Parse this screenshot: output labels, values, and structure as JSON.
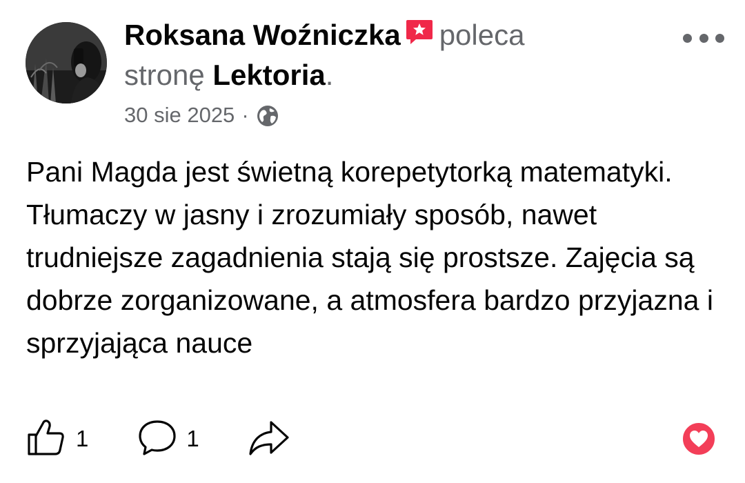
{
  "post": {
    "author": "Roksana Woźniczka",
    "recommends_text": "poleca",
    "page_prefix": "stronę",
    "page_name": "Lektoria",
    "page_suffix": ".",
    "date": "30 sie 2025",
    "separator": "·",
    "body": "Pani Magda jest świetną korepetytorką matematyki. Tłumaczy w jasny i zrozumiały sposób, nawet trudniejsze zagadnienia stają się prostsze. Zajęcia są dobrze zorganizowane, a atmosfera bardzo przyjazna i sprzyjająca nauce"
  },
  "actions": {
    "like_count": "1",
    "comment_count": "1"
  },
  "icons": {
    "recommend_badge": "recommend-badge-icon",
    "privacy": "globe-icon",
    "more": "more-options-icon",
    "like": "thumbs-up-icon",
    "comment": "comment-icon",
    "share": "share-icon",
    "reaction": "heart-reaction-icon"
  },
  "colors": {
    "recommend_badge": "#f02849",
    "reaction_heart": "#f33e58",
    "secondary_text": "#65676b"
  }
}
